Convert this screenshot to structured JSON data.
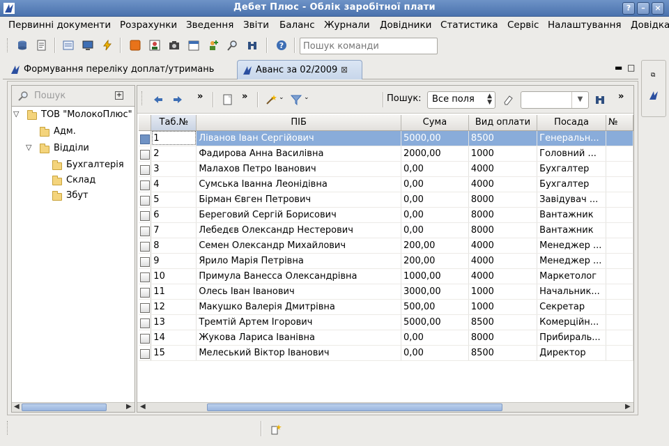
{
  "window": {
    "title": "Дебет Плюс - Облік заробітної плати",
    "icon": "app-logo-icon"
  },
  "menu": [
    "Первинні документи",
    "Розрахунки",
    "Зведення",
    "Звіти",
    "Баланс",
    "Журнали",
    "Довідники",
    "Статистика",
    "Сервіс",
    "Налаштування",
    "Довідка"
  ],
  "toolbar": {
    "command_search_placeholder": "Пошук команди",
    "icons": [
      "database-icon",
      "document-edit-icon",
      "list-icon",
      "monitor-icon",
      "lightning-icon",
      "stop-icon",
      "person-card-icon",
      "camera-icon",
      "calendar-icon",
      "add-user-icon",
      "magnifier-icon",
      "binoculars-icon",
      "help-icon"
    ]
  },
  "tabs": [
    {
      "label": "Формування переліку доплат/утримань",
      "active": false
    },
    {
      "label": "Аванс за 02/2009",
      "active": true
    }
  ],
  "tree": {
    "search_placeholder": "Пошук",
    "nodes": [
      {
        "label": "ТОВ \"МолокоПлюс\"",
        "level": 0,
        "expanded": true
      },
      {
        "label": "Адм.",
        "level": 1,
        "expanded": null
      },
      {
        "label": "Відділи",
        "level": 1,
        "expanded": true
      },
      {
        "label": "Бухгалтерія",
        "level": 2,
        "expanded": null
      },
      {
        "label": "Склад",
        "level": 2,
        "expanded": null
      },
      {
        "label": "Збут",
        "level": 2,
        "expanded": null
      }
    ]
  },
  "grid_toolbar": {
    "search_label": "Пошук:",
    "search_field_value": "Все поля",
    "search_value": ""
  },
  "grid": {
    "columns": [
      "Таб.№",
      "ПІБ",
      "Сума",
      "Вид оплати",
      "Посада",
      "№"
    ],
    "rows": [
      [
        "1",
        "Ліванов Іван Сергійович",
        "5000,00",
        "8500",
        "Генеральн..."
      ],
      [
        "2",
        "Фадирова Анна Василівна",
        "2000,00",
        "1000",
        "Головний ..."
      ],
      [
        "3",
        "Малахов Петро Іванович",
        "0,00",
        "4000",
        "Бухгалтер"
      ],
      [
        "4",
        "Сумська Іванна Леонідівна",
        "0,00",
        "4000",
        "Бухгалтер"
      ],
      [
        "5",
        "Бірман Євген Петрович",
        "0,00",
        "8000",
        "Завідувач ..."
      ],
      [
        "6",
        "Береговий Сергій Борисович",
        "0,00",
        "8000",
        "Вантажник"
      ],
      [
        "7",
        "Лебедєв Олександр Нестерович",
        "0,00",
        "8000",
        "Вантажник"
      ],
      [
        "8",
        "Семен Олександр Михайлович",
        "200,00",
        "4000",
        "Менеджер ..."
      ],
      [
        "9",
        "Ярило Марія Петрівна",
        "200,00",
        "4000",
        "Менеджер ..."
      ],
      [
        "10",
        "Примула Ванесса Олександрівна",
        "1000,00",
        "4000",
        "Маркетолог"
      ],
      [
        "11",
        "Олесь Іван Іванович",
        "3000,00",
        "1000",
        "Начальник..."
      ],
      [
        "12",
        "Макушко Валерія Дмитрівна",
        "500,00",
        "1000",
        "Секретар"
      ],
      [
        "13",
        "Тремтій Артем Ігорович",
        "5000,00",
        "8500",
        "Комерційн..."
      ],
      [
        "14",
        "Жукова Лариса Іванівна",
        "0,00",
        "8000",
        "Прибираль..."
      ],
      [
        "15",
        "Мелеський Віктор Іванович",
        "0,00",
        "8500",
        "Директор"
      ]
    ],
    "selected_row": 0
  },
  "colors": {
    "title_bar": "#5a7fb8",
    "selection": "#89acda"
  }
}
